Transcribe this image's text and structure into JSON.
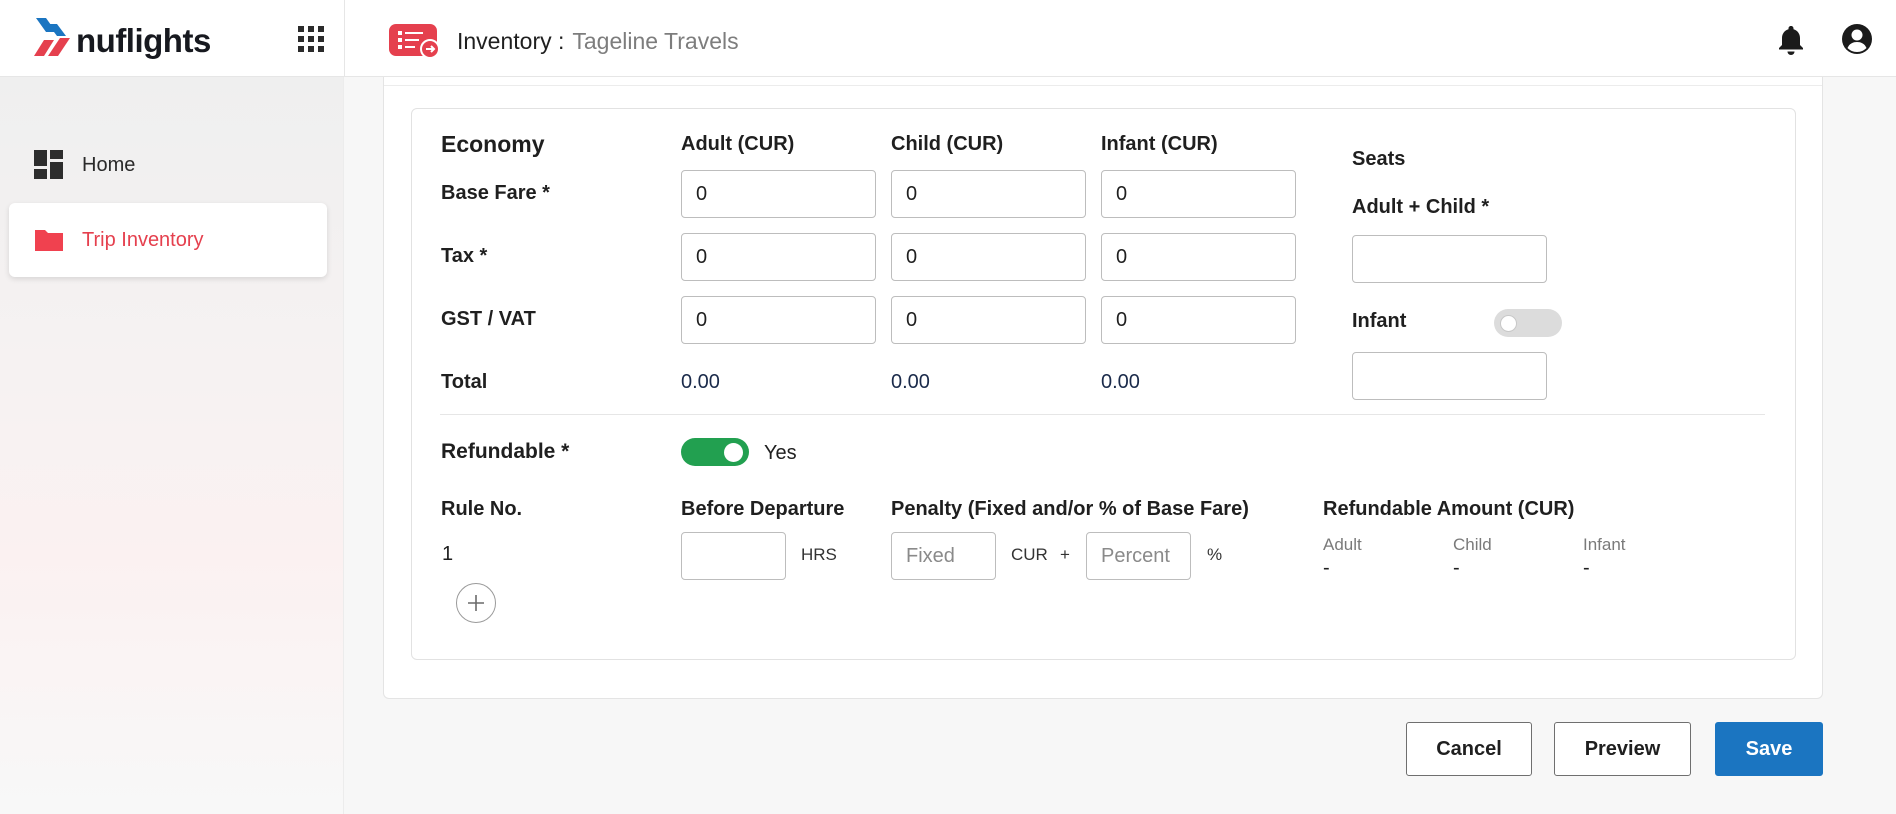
{
  "app": {
    "brand": "nuflights",
    "page_title": "Inventory :",
    "page_subtitle": "Tageline Travels"
  },
  "icons": {
    "apps": "grid-apps-icon",
    "page": "ticket-inventory-icon",
    "notifications": "bell-icon",
    "account": "account-circle-icon",
    "home": "dashboard-icon",
    "trip": "folder-icon",
    "add": "plus-icon"
  },
  "colors": {
    "brand_red": "#e5404e",
    "brand_blue": "#1b75c1",
    "toggle_on": "#22a050",
    "brand_navy": "#17191f"
  },
  "sidebar": {
    "items": [
      {
        "label": "Home",
        "active": false
      },
      {
        "label": "Trip Inventory",
        "active": true
      }
    ]
  },
  "fares": {
    "class_label": "Economy",
    "columns": [
      "Adult (CUR)",
      "Child (CUR)",
      "Infant (CUR)"
    ],
    "rows": [
      {
        "label": "Base Fare *",
        "values": [
          "0",
          "0",
          "0"
        ]
      },
      {
        "label": "Tax *",
        "values": [
          "0",
          "0",
          "0"
        ]
      },
      {
        "label": "GST / VAT",
        "values": [
          "0",
          "0",
          "0"
        ]
      }
    ],
    "total": {
      "label": "Total",
      "values": [
        "0.00",
        "0.00",
        "0.00"
      ]
    }
  },
  "seats": {
    "title": "Seats",
    "adult_child_label": "Adult + Child *",
    "adult_child_value": "",
    "infant_label": "Infant",
    "infant_enabled": false,
    "infant_value": ""
  },
  "refund": {
    "label": "Refundable *",
    "enabled": true,
    "enabled_text": "Yes",
    "headers": {
      "rule_no": "Rule No.",
      "before_departure": "Before Departure",
      "penalty": "Penalty (Fixed and/or % of Base Fare)",
      "refundable_amount": "Refundable Amount (CUR)"
    },
    "rules": [
      {
        "rule_no": "1",
        "hours_value": "",
        "hours_unit": "HRS",
        "fixed_placeholder": "Fixed",
        "currency_unit": "CUR",
        "plus": "+",
        "percent_placeholder": "Percent",
        "percent_unit": "%",
        "amounts": [
          {
            "label": "Adult",
            "value": "-"
          },
          {
            "label": "Child",
            "value": "-"
          },
          {
            "label": "Infant",
            "value": "-"
          }
        ]
      }
    ]
  },
  "actions": {
    "cancel": "Cancel",
    "preview": "Preview",
    "save": "Save"
  }
}
